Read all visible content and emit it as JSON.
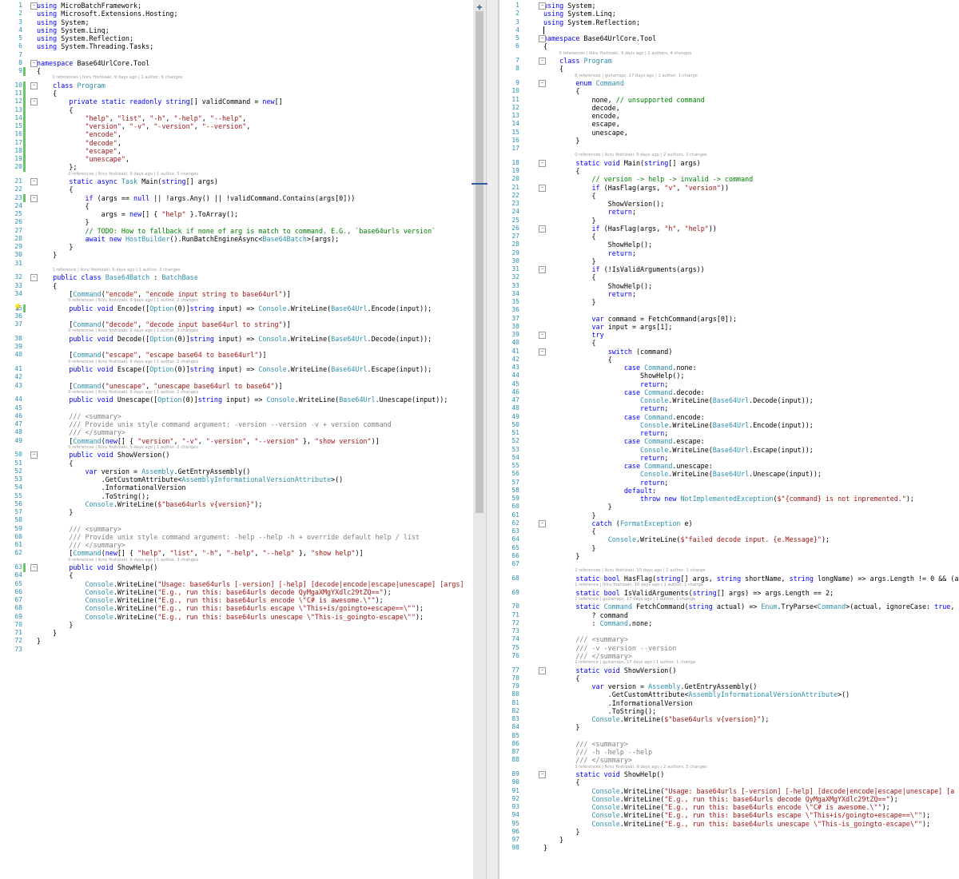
{
  "colors": {
    "keyword": "#0000ff",
    "type": "#2b91af",
    "string": "#a31515",
    "comment": "#008000",
    "lineNumber": "#2b91af",
    "changeBar": "#6ac46a"
  },
  "splitter": {
    "icon": "plus-icon"
  },
  "left": {
    "lines": [
      {
        "n": "1",
        "t": "using MicroBatchFramework;"
      },
      {
        "n": "2",
        "t": "using Microsoft.Extensions.Hosting;"
      },
      {
        "n": "3",
        "t": "using System;"
      },
      {
        "n": "4",
        "t": "using System.Linq;"
      },
      {
        "n": "5",
        "t": "using System.Reflection;"
      },
      {
        "n": "6",
        "t": "using System.Threading.Tasks;"
      },
      {
        "n": "7",
        "t": ""
      },
      {
        "n": "8",
        "t": "namespace Base64UrlCore.Tool"
      },
      {
        "n": "9",
        "t": "{"
      },
      {
        "n": "10",
        "t": "    class Program",
        "lens": "0 references | Ikiru Yoshizaki, 9 days ago | 1 author, 6 changes"
      },
      {
        "n": "11",
        "t": "    {"
      },
      {
        "n": "12",
        "t": "        private static readonly string[] validCommand = new[]"
      },
      {
        "n": "13",
        "t": "        {"
      },
      {
        "n": "14",
        "t": "            \"help\", \"list\", \"-h\", \"-help\", \"--help\","
      },
      {
        "n": "15",
        "t": "            \"version\", \"-v\", \"-version\", \"--version\","
      },
      {
        "n": "16",
        "t": "            \"encode\","
      },
      {
        "n": "17",
        "t": "            \"decode\","
      },
      {
        "n": "18",
        "t": "            \"escape\","
      },
      {
        "n": "19",
        "t": "            \"unescape\","
      },
      {
        "n": "20",
        "t": "        };"
      },
      {
        "n": "21",
        "t": "        static async Task Main(string[] args)",
        "lens": "0 references | Ikiru Yoshizaki, 9 days ago | 1 author, 5 changes"
      },
      {
        "n": "22",
        "t": "        {"
      },
      {
        "n": "23",
        "t": "            if (args == null || !args.Any() || !validCommand.Contains(args[0]))"
      },
      {
        "n": "24",
        "t": "            {"
      },
      {
        "n": "25",
        "t": "                args = new[] { \"help\" }.ToArray();"
      },
      {
        "n": "26",
        "t": "            }"
      },
      {
        "n": "27",
        "t": "            // TODO: How to fallback if none of arg is match to command. E.G., `base64urls version`"
      },
      {
        "n": "28",
        "t": "            await new HostBuilder().RunBatchEngineAsync<Base64Batch>(args);"
      },
      {
        "n": "29",
        "t": "        }"
      },
      {
        "n": "30",
        "t": "    }"
      },
      {
        "n": "31",
        "t": ""
      },
      {
        "n": "32",
        "t": "    public class Base64Batch : BatchBase",
        "lens": "1 reference | Ikiru Yoshizaki, 9 days ago | 1 author, 3 changes"
      },
      {
        "n": "33",
        "t": "    {"
      },
      {
        "n": "34",
        "t": "        [Command(\"encode\", \"encode input string to base64url\")]"
      },
      {
        "n": "35",
        "t": "        public void Encode([Option(0)]string input) => Console.WriteLine(Base64Url.Encode(input));",
        "lens": "0 references | Ikiru Yoshizaki, 9 days ago | 1 author, 2 changes"
      },
      {
        "n": "36",
        "t": ""
      },
      {
        "n": "37",
        "t": "        [Command(\"decode\", \"decode input base64url to string\")]"
      },
      {
        "n": "38",
        "t": "        public void Decode([Option(0)]string input) => Console.WriteLine(Base64Url.Decode(input));",
        "lens": "0 references | Ikiru Yoshizaki, 9 days ago | 1 author, 2 changes"
      },
      {
        "n": "39",
        "t": ""
      },
      {
        "n": "40",
        "t": "        [Command(\"escape\", \"escape base64 to base64url\")]"
      },
      {
        "n": "41",
        "t": "        public void Escape([Option(0)]string input) => Console.WriteLine(Base64Url.Escape(input));",
        "lens": "0 references | Ikiru Yoshizaki, 9 days ago | 1 author, 2 changes"
      },
      {
        "n": "42",
        "t": ""
      },
      {
        "n": "43",
        "t": "        [Command(\"unescape\", \"unescape base64url to base64\")]"
      },
      {
        "n": "44",
        "t": "        public void Unescape([Option(0)]string input) => Console.WriteLine(Base64Url.Unescape(input));",
        "lens": "0 references | Ikiru Yoshizaki, 9 days ago | 1 author, 2 changes"
      },
      {
        "n": "45",
        "t": ""
      },
      {
        "n": "46",
        "t": "        /// <summary>"
      },
      {
        "n": "47",
        "t": "        /// Provide unix style command argument: -version --version -v + version command"
      },
      {
        "n": "48",
        "t": "        /// </summary>"
      },
      {
        "n": "49",
        "t": "        [Command(new[] { \"version\", \"-v\", \"-version\", \"--version\" }, \"show version\")]"
      },
      {
        "n": "50",
        "t": "        public void ShowVersion()",
        "lens": "0 references | Ikiru Yoshizaki, 9 days ago | 1 author, 2 changes"
      },
      {
        "n": "51",
        "t": "        {"
      },
      {
        "n": "52",
        "t": "            var version = Assembly.GetEntryAssembly()"
      },
      {
        "n": "53",
        "t": "                .GetCustomAttribute<AssemblyInformationalVersionAttribute>()"
      },
      {
        "n": "54",
        "t": "                .InformationalVersion"
      },
      {
        "n": "55",
        "t": "                .ToString();"
      },
      {
        "n": "56",
        "t": "            Console.WriteLine($\"base64urls v{version}\");"
      },
      {
        "n": "57",
        "t": "        }"
      },
      {
        "n": "58",
        "t": ""
      },
      {
        "n": "59",
        "t": "        /// <summary>"
      },
      {
        "n": "60",
        "t": "        /// Provide unix style command argument: -help --help -h + override default help / list"
      },
      {
        "n": "61",
        "t": "        /// </summary>"
      },
      {
        "n": "62",
        "t": "        [Command(new[] { \"help\", \"list\", \"-h\", \"-help\", \"--help\" }, \"show help\")]"
      },
      {
        "n": "63",
        "t": "        public void ShowHelp()",
        "lens": "0 references | Ikiru Yoshizaki, 9 days ago | 1 author, 3 changes"
      },
      {
        "n": "64",
        "t": "        {"
      },
      {
        "n": "65",
        "t": "            Console.WriteLine(\"Usage: base64urls [-version] [-help] [decode|encode|escape|unescape] [args]"
      },
      {
        "n": "66",
        "t": "            Console.WriteLine(\"E.g., run this: base64urls decode QyMgaXMgYXdlc29tZQ==\");"
      },
      {
        "n": "67",
        "t": "            Console.WriteLine(\"E.g., run this: base64urls encode \\\"C# is awesome.\\\"\");"
      },
      {
        "n": "68",
        "t": "            Console.WriteLine(\"E.g., run this: base64urls escape \\\"This+is/goingto+escape==\\\"\");"
      },
      {
        "n": "69",
        "t": "            Console.WriteLine(\"E.g., run this: base64urls unescape \\\"This-is_goingto-escape\\\"\");"
      },
      {
        "n": "70",
        "t": "        }"
      },
      {
        "n": "71",
        "t": "    }"
      },
      {
        "n": "72",
        "t": "}"
      },
      {
        "n": "73",
        "t": ""
      }
    ]
  },
  "right": {
    "lines": [
      {
        "n": "1",
        "t": "using System;"
      },
      {
        "n": "2",
        "t": "using System.Linq;"
      },
      {
        "n": "3",
        "t": "using System.Reflection;"
      },
      {
        "n": "4",
        "t": ""
      },
      {
        "n": "5",
        "t": "namespace Base64UrlCore.Tool"
      },
      {
        "n": "6",
        "t": "{"
      },
      {
        "n": "7",
        "t": "    class Program",
        "lens": "0 references | Ikiru Yoshizaki, 9 days ago | 2 authors, 4 changes"
      },
      {
        "n": "8",
        "t": "    {"
      },
      {
        "n": "9",
        "t": "        enum Command",
        "lens": "8 references | guitarrapc, 17 days ago | 1 author, 1 change"
      },
      {
        "n": "10",
        "t": "        {"
      },
      {
        "n": "11",
        "t": "            none, // unsupported command"
      },
      {
        "n": "12",
        "t": "            decode,"
      },
      {
        "n": "13",
        "t": "            encode,"
      },
      {
        "n": "14",
        "t": "            escape,"
      },
      {
        "n": "15",
        "t": "            unescape,"
      },
      {
        "n": "16",
        "t": "        }"
      },
      {
        "n": "17",
        "t": ""
      },
      {
        "n": "18",
        "t": "        static void Main(string[] args)",
        "lens": "0 references | Ikiru Yoshizaki, 9 days ago | 2 authors, 3 changes"
      },
      {
        "n": "19",
        "t": "        {"
      },
      {
        "n": "20",
        "t": "            // version -> help -> invalid -> command"
      },
      {
        "n": "21",
        "t": "            if (HasFlag(args, \"v\", \"version\"))"
      },
      {
        "n": "22",
        "t": "            {"
      },
      {
        "n": "23",
        "t": "                ShowVersion();"
      },
      {
        "n": "24",
        "t": "                return;"
      },
      {
        "n": "25",
        "t": "            }"
      },
      {
        "n": "26",
        "t": "            if (HasFlag(args, \"h\", \"help\"))"
      },
      {
        "n": "27",
        "t": "            {"
      },
      {
        "n": "28",
        "t": "                ShowHelp();"
      },
      {
        "n": "29",
        "t": "                return;"
      },
      {
        "n": "30",
        "t": "            }"
      },
      {
        "n": "31",
        "t": "            if (!IsValidArguments(args))"
      },
      {
        "n": "32",
        "t": "            {"
      },
      {
        "n": "33",
        "t": "                ShowHelp();"
      },
      {
        "n": "34",
        "t": "                return;"
      },
      {
        "n": "35",
        "t": "            }"
      },
      {
        "n": "36",
        "t": ""
      },
      {
        "n": "37",
        "t": "            var command = FetchCommand(args[0]);"
      },
      {
        "n": "38",
        "t": "            var input = args[1];"
      },
      {
        "n": "39",
        "t": "            try"
      },
      {
        "n": "40",
        "t": "            {"
      },
      {
        "n": "41",
        "t": "                switch (command)"
      },
      {
        "n": "42",
        "t": "                {"
      },
      {
        "n": "43",
        "t": "                    case Command.none:"
      },
      {
        "n": "44",
        "t": "                        ShowHelp();"
      },
      {
        "n": "45",
        "t": "                        return;"
      },
      {
        "n": "46",
        "t": "                    case Command.decode:"
      },
      {
        "n": "47",
        "t": "                        Console.WriteLine(Base64Url.Decode(input));"
      },
      {
        "n": "48",
        "t": "                        return;"
      },
      {
        "n": "49",
        "t": "                    case Command.encode:"
      },
      {
        "n": "50",
        "t": "                        Console.WriteLine(Base64Url.Encode(input));"
      },
      {
        "n": "51",
        "t": "                        return;"
      },
      {
        "n": "52",
        "t": "                    case Command.escape:"
      },
      {
        "n": "53",
        "t": "                        Console.WriteLine(Base64Url.Escape(input));"
      },
      {
        "n": "54",
        "t": "                        return;"
      },
      {
        "n": "55",
        "t": "                    case Command.unescape:"
      },
      {
        "n": "56",
        "t": "                        Console.WriteLine(Base64Url.Unescape(input));"
      },
      {
        "n": "57",
        "t": "                        return;"
      },
      {
        "n": "58",
        "t": "                    default:"
      },
      {
        "n": "59",
        "t": "                        throw new NotImplementedException($\"{command} is not inpremented.\");"
      },
      {
        "n": "60",
        "t": "                }"
      },
      {
        "n": "61",
        "t": "            }"
      },
      {
        "n": "62",
        "t": "            catch (FormatException e)"
      },
      {
        "n": "63",
        "t": "            {"
      },
      {
        "n": "64",
        "t": "                Console.WriteLine($\"failed decode input. {e.Message}\");"
      },
      {
        "n": "65",
        "t": "            }"
      },
      {
        "n": "66",
        "t": "        }"
      },
      {
        "n": "67",
        "t": ""
      },
      {
        "n": "68",
        "t": "        static bool HasFlag(string[] args, string shortName, string longName) => args.Length != 0 && (a",
        "lens": "2 references | Ikiru Yoshizaki, 10 days ago | 1 author, 1 change"
      },
      {
        "n": "69",
        "t": "        static bool IsValidArguments(string[] args) => args.Length == 2;",
        "lens": "1 reference | Ikiru Yoshizaki, 10 days ago | 1 author, 1 change"
      },
      {
        "n": "70",
        "t": "        static Command FetchCommand(string actual) => Enum.TryParse<Command>(actual, ignoreCase: true, o",
        "lens": "1 reference | guitarrapc, 17 days ago | 1 author, 1 change"
      },
      {
        "n": "71",
        "t": "            ? command"
      },
      {
        "n": "72",
        "t": "            : Command.none;"
      },
      {
        "n": "73",
        "t": ""
      },
      {
        "n": "74",
        "t": "        /// <summary>"
      },
      {
        "n": "75",
        "t": "        /// -v -version --version"
      },
      {
        "n": "76",
        "t": "        /// </summary>"
      },
      {
        "n": "77",
        "t": "        static void ShowVersion()",
        "lens": "1 reference | guitarrapc, 17 days ago | 1 author, 1 change"
      },
      {
        "n": "78",
        "t": "        {"
      },
      {
        "n": "79",
        "t": "            var version = Assembly.GetEntryAssembly()"
      },
      {
        "n": "80",
        "t": "                .GetCustomAttribute<AssemblyInformationalVersionAttribute>()"
      },
      {
        "n": "81",
        "t": "                .InformationalVersion"
      },
      {
        "n": "82",
        "t": "                .ToString();"
      },
      {
        "n": "83",
        "t": "            Console.WriteLine($\"base64urls v{version}\");"
      },
      {
        "n": "84",
        "t": "        }"
      },
      {
        "n": "85",
        "t": ""
      },
      {
        "n": "86",
        "t": "        /// <summary>"
      },
      {
        "n": "87",
        "t": "        /// -h -help --help"
      },
      {
        "n": "88",
        "t": "        /// </summary>"
      },
      {
        "n": "89",
        "t": "        static void ShowHelp()",
        "lens": "3 references | Ikiru Yoshizaki, 9 days ago | 2 authors, 3 changes"
      },
      {
        "n": "90",
        "t": "        {"
      },
      {
        "n": "91",
        "t": "            Console.WriteLine(\"Usage: base64urls [-version] [-help] [decode|encode|escape|unescape] [a"
      },
      {
        "n": "92",
        "t": "            Console.WriteLine(\"E.g., run this: base64urls decode QyMgaXMgYXdlc29tZQ==\");"
      },
      {
        "n": "93",
        "t": "            Console.WriteLine(\"E.g., run this: base64urls encode \\\"C# is awesome.\\\"\");"
      },
      {
        "n": "94",
        "t": "            Console.WriteLine(\"E.g., run this: base64urls escape \\\"This+is/goingto+escape==\\\"\");"
      },
      {
        "n": "95",
        "t": "            Console.WriteLine(\"E.g., run this: base64urls unescape \\\"This-is_goingto-escape\\\"\");"
      },
      {
        "n": "96",
        "t": "        }"
      },
      {
        "n": "97",
        "t": "    }"
      },
      {
        "n": "98",
        "t": "}"
      }
    ]
  }
}
